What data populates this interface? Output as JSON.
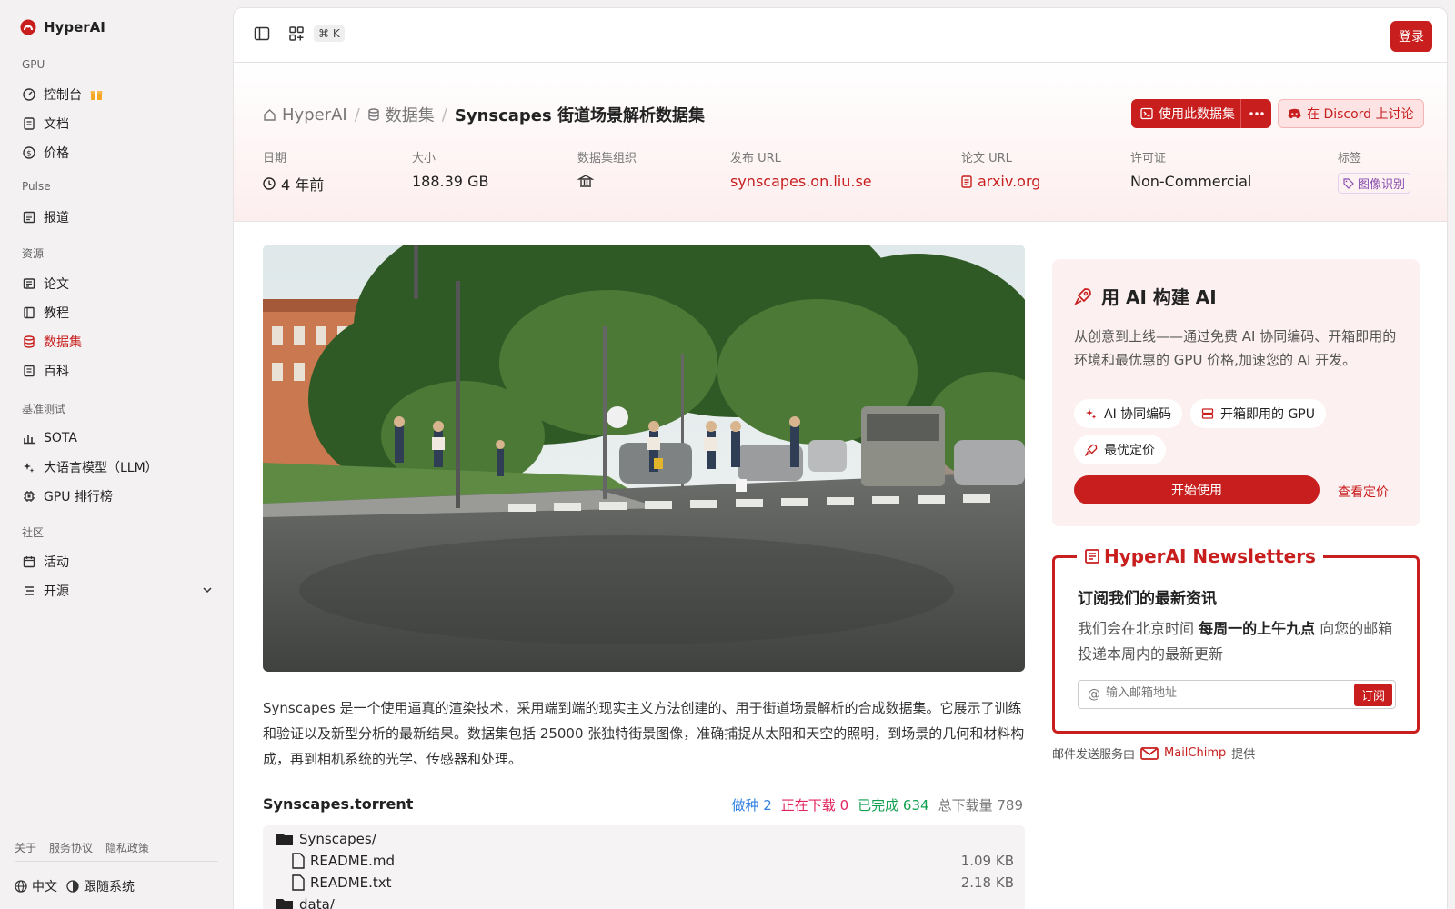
{
  "brand": {
    "name": "HyperAI"
  },
  "sidebar": {
    "groups": {
      "gpu": "GPU",
      "pulse": "Pulse",
      "resources": "资源",
      "benchmark": "基准测试",
      "community": "社区"
    },
    "items": {
      "console": "控制台",
      "docs": "文档",
      "pricing": "价格",
      "reports": "报道",
      "papers": "论文",
      "tutorials": "教程",
      "datasets": "数据集",
      "wiki": "百科",
      "sota": "SOTA",
      "llm": "大语言模型（LLM）",
      "gpu_rank": "GPU 排行榜",
      "events": "活动",
      "opensource": "开源"
    },
    "footer": {
      "about": "关于",
      "terms": "服务协议",
      "privacy": "隐私政策",
      "language": "中文",
      "theme": "跟随系统"
    }
  },
  "topbar": {
    "shortcut": "⌘ K",
    "login": "登录"
  },
  "breadcrumb": {
    "home": "HyperAI",
    "section": "数据集",
    "current": "Synscapes 街道场景解析数据集"
  },
  "actions": {
    "use_dataset": "使用此数据集",
    "discord": "在 Discord 上讨论"
  },
  "meta": {
    "date_label": "日期",
    "date_value": "4 年前",
    "size_label": "大小",
    "size_value": "188.39 GB",
    "org_label": "数据集组织",
    "url_label": "发布 URL",
    "url_value": "synscapes.on.liu.se",
    "paper_label": "论文 URL",
    "paper_value": "arxiv.org",
    "license_label": "许可证",
    "license_value": "Non-Commercial",
    "tags_label": "标签",
    "tag": "图像识别"
  },
  "description": "Synscapes 是一个使用逼真的渲染技术，采用端到端的现实主义方法创建的、用于街道场景解析的合成数据集。它展示了训练和验证以及新型分析的最新结果。数据集包括 25000 张独特街景图像，准确捕捉从太阳和天空的照明，到场景的几何和材料构成，再到相机系统的光学、传感器和处理。",
  "torrent": {
    "name": "Synscapes.torrent",
    "seeds_label": "做种",
    "seeds": "2",
    "downloading_label": "正在下载",
    "downloading": "0",
    "completed_label": "已完成",
    "completed": "634",
    "total_label": "总下载量",
    "total": "789",
    "files": [
      {
        "name": "Synscapes/",
        "size": ""
      },
      {
        "name": "README.md",
        "size": "1.09 KB"
      },
      {
        "name": "README.txt",
        "size": "2.18 KB"
      },
      {
        "name": "data/",
        "size": ""
      }
    ]
  },
  "promo": {
    "title": "用 AI 构建 AI",
    "text": "从创意到上线——通过免费 AI 协同编码、开箱即用的环境和最优惠的 GPU 价格,加速您的 AI 开发。",
    "chips": [
      "AI 协同编码",
      "开箱即用的 GPU",
      "最优定价"
    ],
    "start": "开始使用",
    "pricing": "查看定价"
  },
  "newsletter": {
    "title": "HyperAI Newsletters",
    "heading": "订阅我们的最新资讯",
    "text_pre": "我们会在北京时间 ",
    "text_bold": "每周一的上午九点",
    "text_post": " 向您的邮箱投递本周内的最新更新",
    "placeholder": "输入邮箱地址",
    "subscribe": "订阅",
    "provider_pre": "邮件发送服务由",
    "provider": "MailChimp",
    "provider_post": "提供"
  },
  "colors": {
    "accent": "#c81e1e",
    "seeds": "#2f7fe0",
    "downloading": "#e0245e",
    "completed": "#12a050"
  }
}
